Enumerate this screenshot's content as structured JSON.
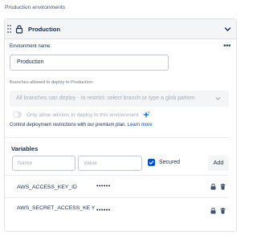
{
  "section": {
    "title": "Production environments"
  },
  "environment": {
    "header_name": "Production",
    "name_label": "Environment name:",
    "name_value": "Production",
    "more_label": "•••",
    "branches_label": "Branches allowed to deploy to Production:",
    "branches_select_value": "All branches can deploy - to restrict: select branch or type a glob pattern",
    "admin_toggle_label": "Only allow admins to deploy to this environment",
    "admin_toggle_on": false,
    "promo_text": "Control deployment restrictions with our premium plan.",
    "promo_link": "Learn more"
  },
  "variables": {
    "title": "Variables",
    "name_placeholder": "Name",
    "value_placeholder": "Value",
    "secured_label": "Secured",
    "secured_checked": true,
    "add_label": "Add",
    "rows": [
      {
        "key": "AWS_ACCESS_KEY_ID",
        "value": "••••••"
      },
      {
        "key": "AWS_SECRET_ACCESS_KE Y",
        "value": "••••••"
      }
    ]
  },
  "colors": {
    "accent": "#0052cc",
    "header_bg": "#f4f5f7",
    "border": "#dfe1e6"
  }
}
